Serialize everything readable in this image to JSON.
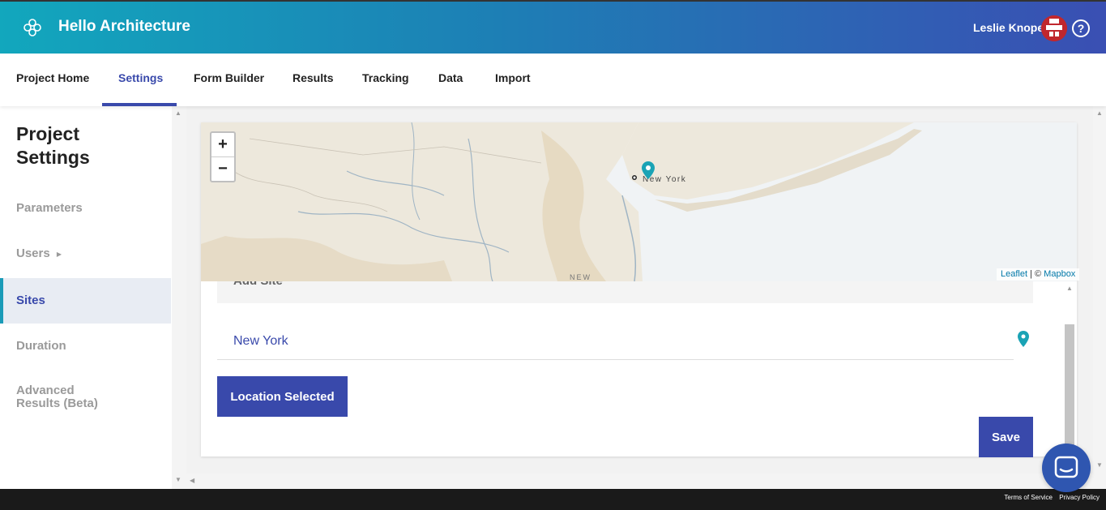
{
  "header": {
    "app_title": "Hello Architecture",
    "user_name": "Leslie Knope",
    "help_symbol": "?",
    "icons": [
      "logo-icon",
      "avatar",
      "help-icon"
    ]
  },
  "nav": {
    "tabs": [
      {
        "label": "Project Home"
      },
      {
        "label": "Settings",
        "active": true
      },
      {
        "label": "Form Builder"
      },
      {
        "label": "Results"
      },
      {
        "label": "Tracking"
      },
      {
        "label": "Data"
      },
      {
        "label": "Import"
      }
    ]
  },
  "sidebar": {
    "title": "Project Settings",
    "items": [
      {
        "label": "Parameters"
      },
      {
        "label": "Users",
        "has_submenu": true
      },
      {
        "label": "Sites",
        "active": true
      },
      {
        "label": "Duration"
      },
      {
        "label": "Advanced Results (Beta)"
      }
    ]
  },
  "map": {
    "zoom_in": "+",
    "zoom_out": "−",
    "place_label": "New York",
    "region_label": "NEW",
    "attribution_leaflet": "Leaflet",
    "attribution_sep": " | © ",
    "attribution_mapbox": "Mapbox"
  },
  "site_form": {
    "section_title": "Add Site",
    "location_value": "New York",
    "location_button": "Location Selected",
    "save_button": "Save"
  },
  "footer": {
    "terms": "Terms of Service",
    "privacy": "Privacy Policy"
  },
  "colors": {
    "accent": "#3949ab",
    "teal": "#12a7bd",
    "pin": "#1aa3b5"
  }
}
